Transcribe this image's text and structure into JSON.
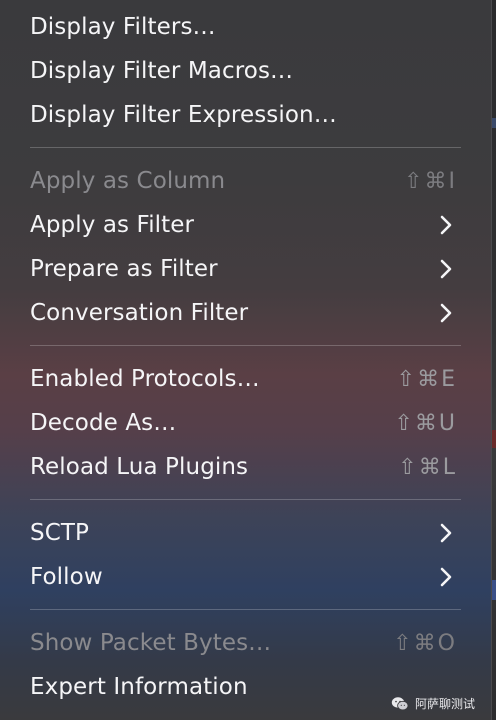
{
  "menu": {
    "items": [
      {
        "label": "Display Filters…"
      },
      {
        "label": "Display Filter Macros…"
      },
      {
        "label": "Display Filter Expression…"
      },
      {
        "label": "Apply as Column",
        "shortcut": "⇧⌘I",
        "disabled": true
      },
      {
        "label": "Apply as Filter",
        "submenu": true
      },
      {
        "label": "Prepare as Filter",
        "submenu": true
      },
      {
        "label": "Conversation Filter",
        "submenu": true
      },
      {
        "label": "Enabled Protocols…",
        "shortcut": "⇧⌘E"
      },
      {
        "label": "Decode As…",
        "shortcut": "⇧⌘U"
      },
      {
        "label": "Reload Lua Plugins",
        "shortcut": "⇧⌘L"
      },
      {
        "label": "SCTP",
        "submenu": true
      },
      {
        "label": "Follow",
        "submenu": true
      },
      {
        "label": "Show Packet Bytes…",
        "shortcut": "⇧⌘O",
        "disabled": true
      },
      {
        "label": "Expert Information"
      }
    ]
  },
  "watermark": {
    "text": "阿萨聊测试",
    "icon": "wechat-icon"
  },
  "colors": {
    "text": "#f5f5f7",
    "disabled_text": "#8a8a8e",
    "shortcut_text": "#9b9b9f",
    "separator": "rgba(255,255,255,0.22)"
  }
}
